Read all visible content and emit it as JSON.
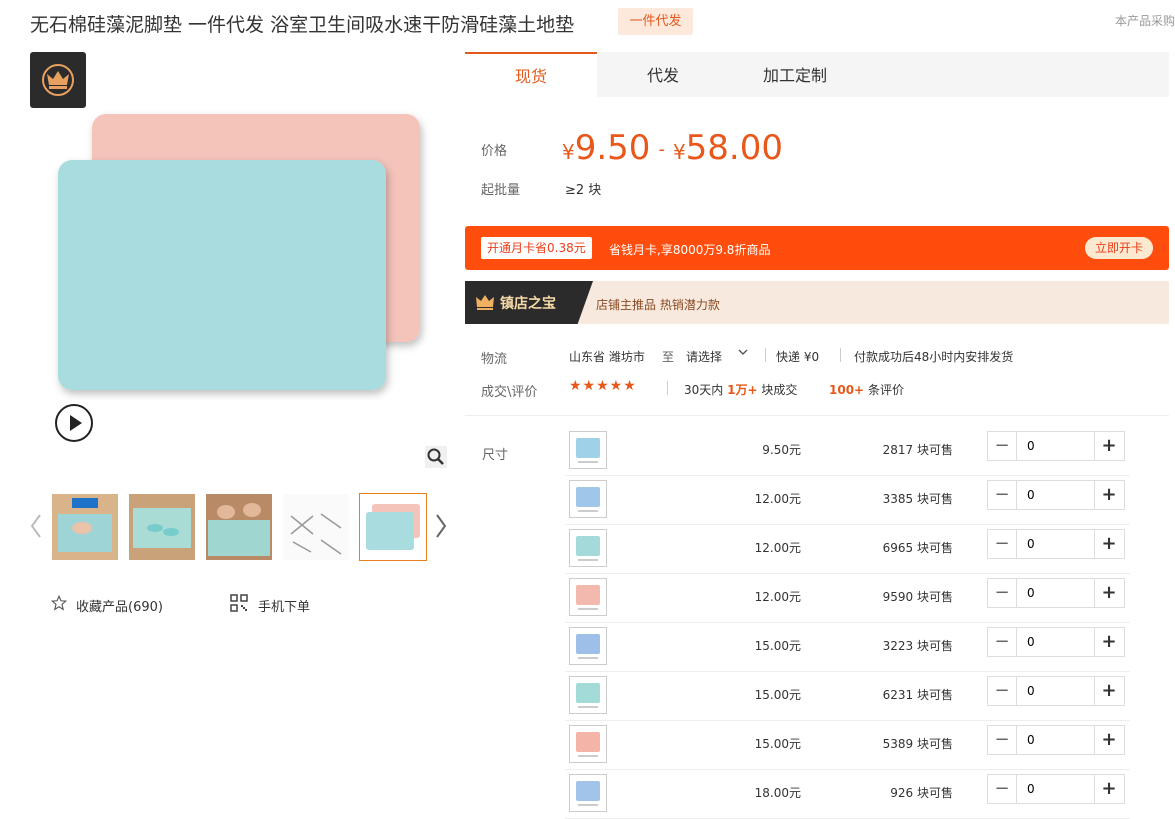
{
  "header": {
    "title": "无石棉硅藻泥脚垫 一件代发 浴室卫生间吸水速干防滑硅藻土地垫",
    "badge": "一件代发",
    "top_right": "本产品采购"
  },
  "gallery": {
    "play_icon": "play-icon",
    "zoom_icon": "search-icon",
    "thumbnails": [
      "thumb-1",
      "thumb-2",
      "thumb-3",
      "thumb-4",
      "thumb-5"
    ],
    "selected_thumbnail_index": 4
  },
  "actions": {
    "favorite_label": "收藏产品(690)",
    "mobile_label": "手机下单"
  },
  "tabs": [
    {
      "label": "现货",
      "active": true
    },
    {
      "label": "代发",
      "active": false
    },
    {
      "label": "加工定制",
      "active": false
    }
  ],
  "price": {
    "label": "价格",
    "currency": "¥",
    "min": "9.50",
    "separator": "-",
    "max": "58.00",
    "moq_label": "起批量",
    "moq_value": "≥2 块"
  },
  "card_banner": {
    "tag": "开通月卡省0.38元",
    "text": "省钱月卡,享8000万9.8折商品",
    "button": "立即开卡"
  },
  "treasure": {
    "title": "镇店之宝",
    "text": "店铺主推品  热销潜力款"
  },
  "logistics": {
    "label": "物流",
    "origin": "山东省 潍坊市",
    "to": "至",
    "select": "请选择",
    "shipping": "快递 ¥0",
    "note": "付款成功后48小时内安排发货"
  },
  "reviews": {
    "label": "成交\\评价",
    "stars": "★★★★★",
    "deals_prefix": "30天内",
    "deals_value": "1万+",
    "deals_suffix": "块成交",
    "reviews_value": "100+",
    "reviews_suffix": "条评价"
  },
  "sku": {
    "label": "尺寸",
    "rows": [
      {
        "price": "9.50元",
        "stock": "2817 块可售",
        "qty": "0",
        "color": "#9fd1e8"
      },
      {
        "price": "12.00元",
        "stock": "3385 块可售",
        "qty": "0",
        "color": "#9ec7ea"
      },
      {
        "price": "12.00元",
        "stock": "6965 块可售",
        "qty": "0",
        "color": "#a5dada"
      },
      {
        "price": "12.00元",
        "stock": "9590 块可售",
        "qty": "0",
        "color": "#f3b8ae"
      },
      {
        "price": "15.00元",
        "stock": "3223 块可售",
        "qty": "0",
        "color": "#9ec0e8"
      },
      {
        "price": "15.00元",
        "stock": "6231 块可售",
        "qty": "0",
        "color": "#a3dbd8"
      },
      {
        "price": "15.00元",
        "stock": "5389 块可售",
        "qty": "0",
        "color": "#f4b5a8"
      },
      {
        "price": "18.00元",
        "stock": "926 块可售",
        "qty": "0",
        "color": "#a2c3ea"
      }
    ]
  }
}
